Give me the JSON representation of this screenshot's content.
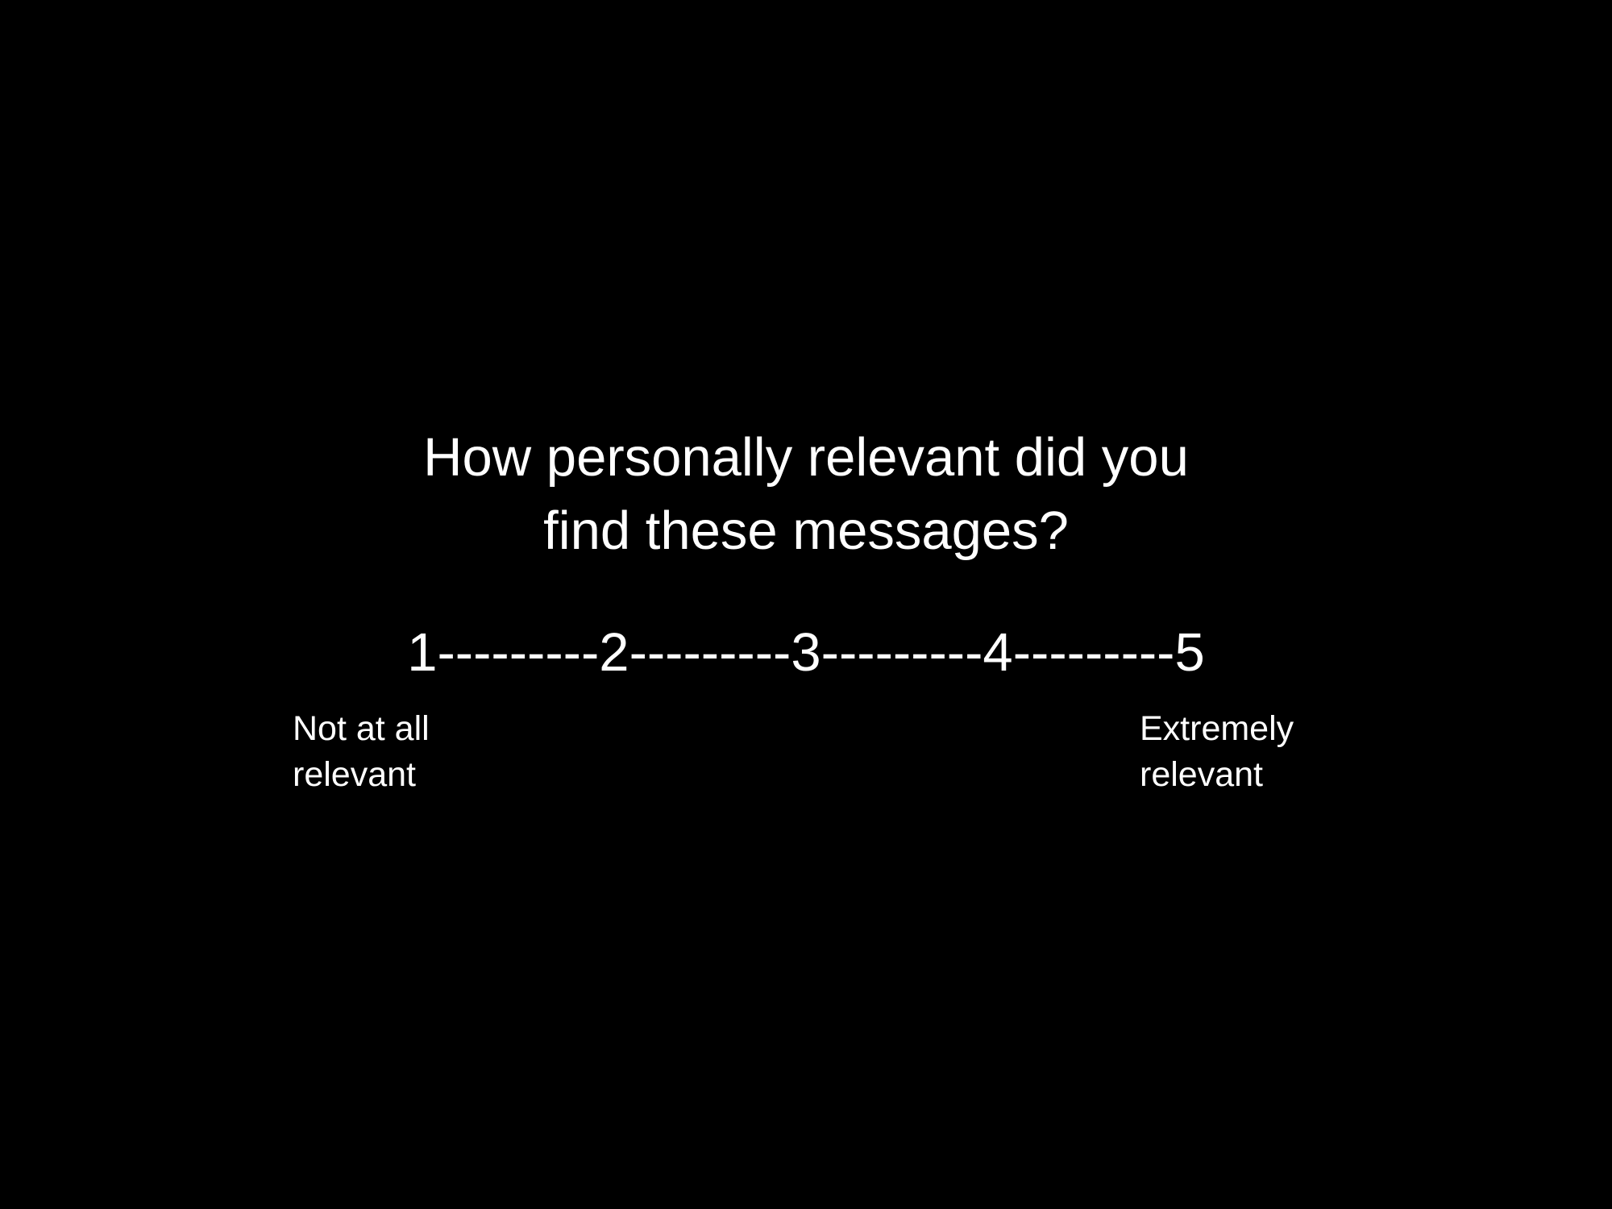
{
  "slide": {
    "background_color": "#000000",
    "text_color": "#ffffff"
  },
  "question": {
    "line1": "How personally relevant did you",
    "line2": "find these messages?"
  },
  "scale": {
    "text": "1---------2---------3---------4---------5",
    "points": [
      1,
      2,
      3,
      4,
      5
    ]
  },
  "anchors": {
    "low": {
      "line1": "Not at all",
      "line2": "relevant"
    },
    "high": {
      "line1": "Extremely",
      "line2": "relevant"
    }
  }
}
